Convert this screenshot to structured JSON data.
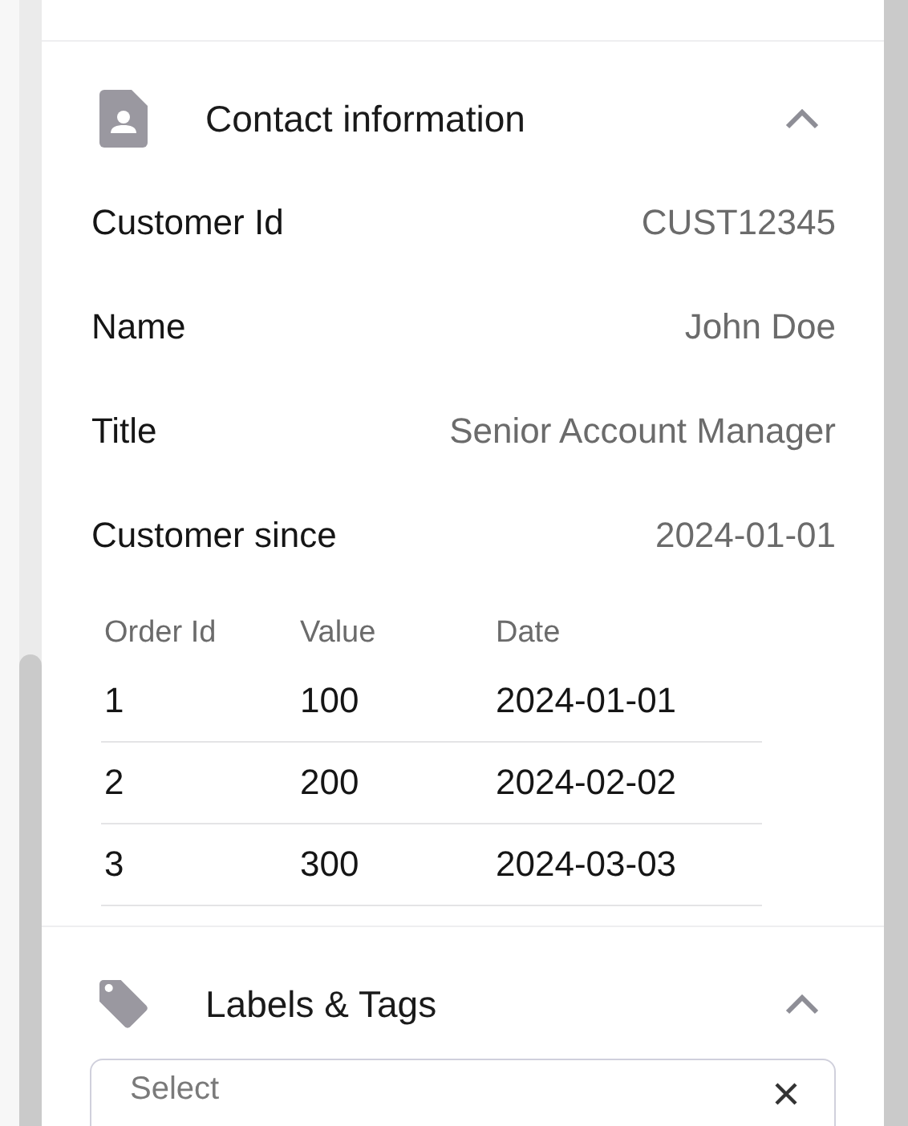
{
  "sections": [
    {
      "kind": "contact",
      "title": "Contact information",
      "expanded": true,
      "fields": [
        {
          "label": "Customer Id",
          "value": "CUST12345"
        },
        {
          "label": "Name",
          "value": "John Doe"
        },
        {
          "label": "Title",
          "value": "Senior Account Manager"
        },
        {
          "label": "Customer since",
          "value": "2024-01-01"
        }
      ],
      "table": {
        "columns": [
          "Order Id",
          "Value",
          "Date"
        ],
        "rows": [
          [
            "1",
            "100",
            "2024-01-01"
          ],
          [
            "2",
            "200",
            "2024-02-02"
          ],
          [
            "3",
            "300",
            "2024-03-03"
          ]
        ]
      }
    },
    {
      "kind": "tags",
      "title": "Labels & Tags",
      "expanded": true,
      "select": {
        "placeholder": "Select"
      }
    }
  ]
}
